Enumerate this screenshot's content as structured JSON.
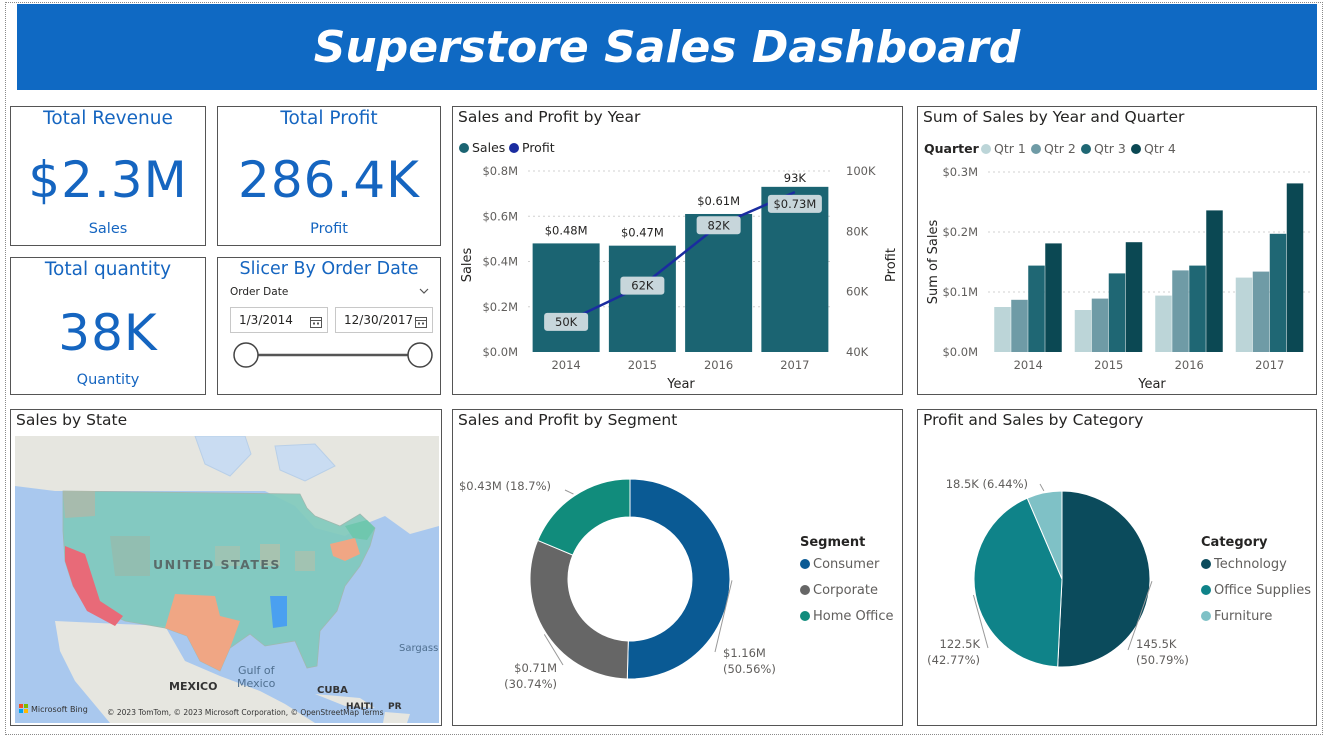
{
  "dashboard": {
    "title": "Superstore Sales Dashboard"
  },
  "kpis": {
    "revenue": {
      "title": "Total Revenue",
      "value": "$2.3M",
      "label": "Sales"
    },
    "profit": {
      "title": "Total Profit",
      "value": "286.4K",
      "label": "Profit"
    },
    "quantity": {
      "title": "Total quantity",
      "value": "38K",
      "label": "Quantity"
    }
  },
  "slicer": {
    "title": "Slicer By Order Date",
    "field": "Order Date",
    "start": "1/3/2014",
    "end": "12/30/2017",
    "range_fraction": [
      0,
      1
    ]
  },
  "map": {
    "title": "Sales by State",
    "labels": [
      "UNITED STATES",
      "Gulf of",
      "Mexico",
      "MEXICO",
      "CUBA",
      "HAITI",
      "PR",
      "Sargass"
    ],
    "attribution": "© 2023 TomTom, © 2023 Microsoft Corporation, © OpenStreetMap  Terms",
    "bing": "Microsoft Bing",
    "colors": {
      "ocean": "#a9c8ee",
      "land": "#e6e6e0",
      "fill": "#7ec9bb",
      "hot": "#e86a78",
      "warm": "#f0a684",
      "blue": "#4aa0f0"
    }
  },
  "colors": {
    "banner": "#0f69c3",
    "kpi_text": "#1565c0",
    "bar": "#1b6472",
    "line": "#1a2ca0",
    "qtr1": "#bcd5d8",
    "qtr2": "#6f9ba6",
    "qtr3": "#1f6774",
    "qtr4": "#0b4853",
    "consumer": "#0a5a94",
    "corporate": "#666666",
    "home_office": "#118c7c",
    "technology": "#0b4b5c",
    "office_supplies": "#0f8389",
    "furniture": "#7fc1c6"
  },
  "chart_data": [
    {
      "id": "sales_profit_year",
      "type": "bar",
      "title": "Sales and Profit by Year",
      "xlabel": "Year",
      "ylabel": "Sales",
      "y2label": "Profit",
      "categories": [
        "2014",
        "2015",
        "2016",
        "2017"
      ],
      "series": [
        {
          "name": "Sales",
          "values": [
            0.48,
            0.47,
            0.61,
            0.73
          ],
          "labels": [
            "$0.48M",
            "$0.47M",
            "$0.61M",
            "$0.73M"
          ]
        },
        {
          "name": "Profit",
          "type": "line",
          "axis": "secondary",
          "values": [
            50,
            62,
            82,
            93
          ],
          "labels": [
            "50K",
            "62K",
            "82K",
            "93K"
          ]
        }
      ],
      "ylim": [
        0,
        0.8
      ],
      "yticks": [
        "$0.0M",
        "$0.2M",
        "$0.4M",
        "$0.6M",
        "$0.8M"
      ],
      "y2lim": [
        40,
        100
      ],
      "y2ticks": [
        "40K",
        "60K",
        "80K",
        "100K"
      ],
      "legend": "top-left",
      "grid": true
    },
    {
      "id": "sales_year_quarter",
      "type": "bar",
      "title": "Sum of Sales by Year and Quarter",
      "xlabel": "Year",
      "ylabel": "Sum of Sales",
      "legend_title": "Quarter",
      "categories": [
        "2014",
        "2015",
        "2016",
        "2017"
      ],
      "series": [
        {
          "name": "Qtr 1",
          "values": [
            0.075,
            0.07,
            0.094,
            0.124
          ]
        },
        {
          "name": "Qtr 2",
          "values": [
            0.087,
            0.089,
            0.136,
            0.134
          ]
        },
        {
          "name": "Qtr 3",
          "values": [
            0.144,
            0.131,
            0.144,
            0.197
          ]
        },
        {
          "name": "Qtr 4",
          "values": [
            0.181,
            0.183,
            0.236,
            0.281
          ]
        }
      ],
      "ylim": [
        0,
        0.3
      ],
      "yticks": [
        "$0.0M",
        "$0.1M",
        "$0.2M",
        "$0.3M"
      ],
      "legend": "top-left",
      "grid": true
    },
    {
      "id": "sales_profit_segment",
      "type": "pie",
      "donut": true,
      "title": "Sales and Profit by Segment",
      "legend_title": "Segment",
      "categories": [
        "Consumer",
        "Corporate",
        "Home Office"
      ],
      "values": [
        1.16,
        0.71,
        0.43
      ],
      "percents": [
        50.56,
        30.74,
        18.7
      ],
      "labels": [
        "$1.16M",
        "$0.71M",
        "$0.43M (18.7%)"
      ],
      "pct_labels": [
        "(50.56%)",
        "(30.74%)",
        ""
      ],
      "legend": "right"
    },
    {
      "id": "profit_sales_category",
      "type": "pie",
      "title": "Profit and Sales by Category",
      "legend_title": "Category",
      "categories": [
        "Technology",
        "Office Supplies",
        "Furniture"
      ],
      "values": [
        145.5,
        122.5,
        18.5
      ],
      "percents": [
        50.79,
        42.77,
        6.44
      ],
      "labels": [
        "145.5K",
        "122.5K",
        "18.5K (6.44%)"
      ],
      "pct_labels": [
        "(50.79%)",
        "(42.77%)",
        ""
      ],
      "legend": "right"
    }
  ]
}
